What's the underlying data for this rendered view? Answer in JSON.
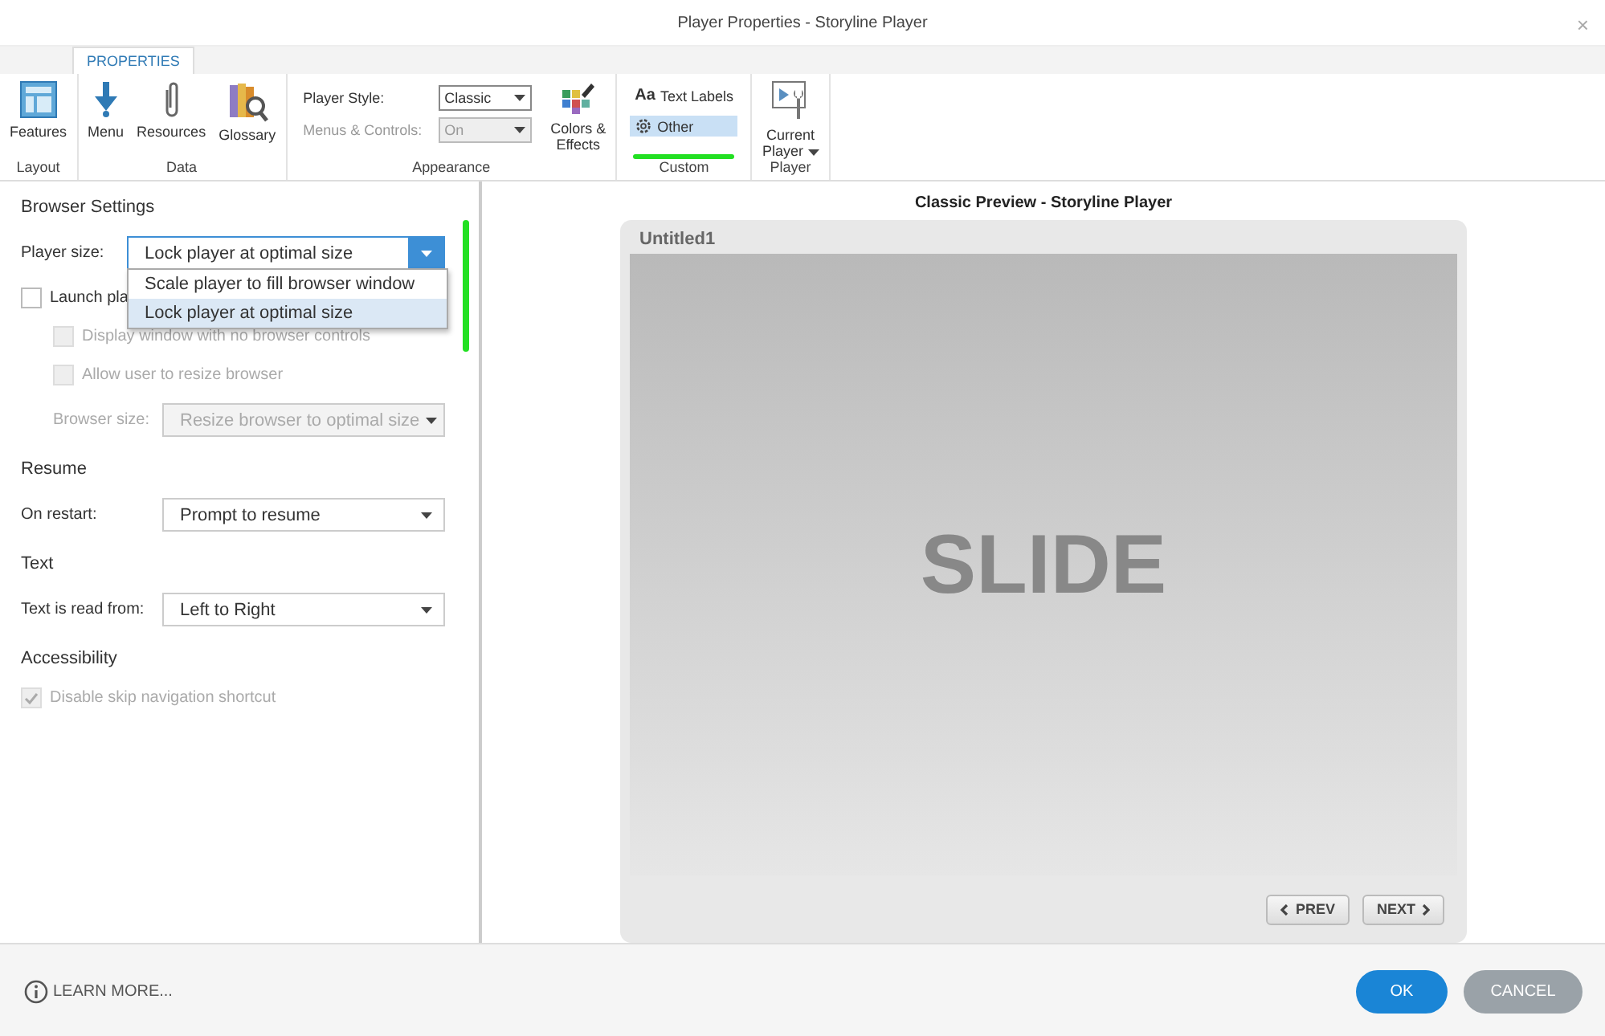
{
  "window": {
    "title": "Player Properties - Storyline Player",
    "close": "×"
  },
  "ribbon": {
    "tabs": [
      {
        "label": "PROPERTIES",
        "selected": true
      }
    ],
    "groups": [
      {
        "label": "Layout",
        "items": [
          {
            "kind": "big",
            "label": "Features"
          }
        ]
      },
      {
        "label": "Data",
        "items": [
          {
            "kind": "big",
            "label": "Menu"
          },
          {
            "kind": "big",
            "label": "Resources"
          },
          {
            "kind": "big",
            "label": "Glossary"
          }
        ]
      },
      {
        "label": "Appearance",
        "items": [
          {
            "kind": "fields",
            "rows": [
              {
                "label": "Player Style:",
                "value": "Classic",
                "disabled": false
              },
              {
                "label": "Menus & Controls:",
                "value": "On",
                "disabled": true
              }
            ]
          },
          {
            "kind": "big",
            "label": "Colors &\nEffects"
          }
        ]
      },
      {
        "label": "Custom",
        "items": [
          {
            "kind": "small",
            "entries": [
              {
                "label": "Text Labels",
                "prefix": "Aa",
                "selected": false
              },
              {
                "label": "Other",
                "selected": true
              }
            ]
          }
        ]
      },
      {
        "label": "Player",
        "items": [
          {
            "kind": "big",
            "label": "Current\nPlayer",
            "caret": true
          }
        ]
      }
    ]
  },
  "settings": [
    {
      "heading": "Browser Settings",
      "rows": [
        {
          "kind": "select",
          "label": "Player size:",
          "value": "Lock player at optimal size",
          "disabled": false,
          "expanded": true,
          "options": [
            {
              "label": "Scale player to fill browser window",
              "selected": false
            },
            {
              "label": "Lock player at optimal size",
              "selected": true
            }
          ]
        },
        {
          "kind": "checkbox",
          "label": "Launch pla",
          "checked": false,
          "disabled": false,
          "children": [
            {
              "kind": "checkbox",
              "label": "Display window with no browser controls",
              "checked": false,
              "disabled": true
            },
            {
              "kind": "checkbox",
              "label": "Allow user to resize browser",
              "checked": false,
              "disabled": true
            },
            {
              "kind": "select",
              "label": "Browser size:",
              "value": "Resize browser to optimal size",
              "disabled": true
            }
          ]
        }
      ]
    },
    {
      "heading": "Resume",
      "rows": [
        {
          "kind": "select",
          "label": "On restart:",
          "value": "Prompt to resume",
          "disabled": false
        }
      ]
    },
    {
      "heading": "Text",
      "rows": [
        {
          "kind": "select",
          "label": "Text is read from:",
          "value": "Left to Right",
          "disabled": false
        }
      ]
    },
    {
      "heading": "Accessibility",
      "rows": [
        {
          "kind": "checkbox",
          "label": "Disable skip navigation shortcut",
          "checked": true,
          "disabled": true
        }
      ]
    }
  ],
  "preview": {
    "title": "Classic Preview - Storyline Player",
    "player_title": "Untitled1",
    "slide_text": "SLIDE",
    "nav": [
      {
        "label": "PREV",
        "kind": "prev"
      },
      {
        "label": "NEXT",
        "kind": "next"
      }
    ]
  },
  "footer": {
    "learn_more": "LEARN MORE...",
    "buttons": [
      {
        "label": "OK",
        "kind": "primary"
      },
      {
        "label": "CANCEL",
        "kind": "secondary"
      }
    ]
  }
}
